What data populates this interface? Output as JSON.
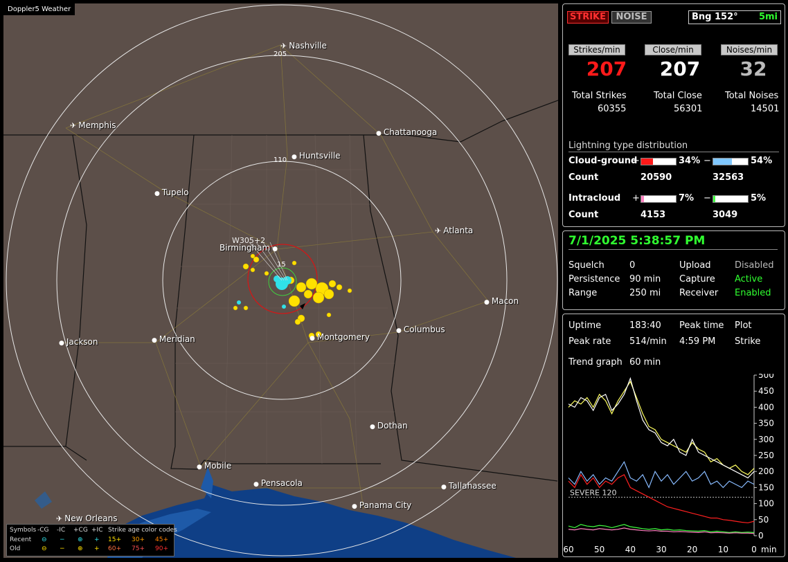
{
  "app_title": "Doppler5 Weather",
  "map": {
    "cities": [
      {
        "name": "Nashville",
        "airport": true
      },
      {
        "name": "Memphis",
        "airport": true
      },
      {
        "name": "Chattanooga",
        "airport": false
      },
      {
        "name": "Huntsville",
        "airport": false
      },
      {
        "name": "Tupelo",
        "airport": false
      },
      {
        "name": "Atlanta",
        "airport": true
      },
      {
        "name": "Birmingham",
        "airport": false
      },
      {
        "name": "Macon",
        "airport": false
      },
      {
        "name": "Columbus",
        "airport": false
      },
      {
        "name": "Jackson",
        "airport": false
      },
      {
        "name": "Meridian",
        "airport": false
      },
      {
        "name": "Montgomery",
        "airport": false
      },
      {
        "name": "Dothan",
        "airport": false
      },
      {
        "name": "Mobile",
        "airport": false
      },
      {
        "name": "Pensacola",
        "airport": false
      },
      {
        "name": "Tallahassee",
        "airport": false
      },
      {
        "name": "Panama City",
        "airport": false
      },
      {
        "name": "New Orleans",
        "airport": true
      }
    ],
    "range_labels": [
      "205",
      "110",
      "15"
    ]
  },
  "legend": {
    "header": [
      "Symbols",
      "-CG",
      "-IC",
      "+CG",
      "+IC",
      "Strike age color codes"
    ],
    "recent": {
      "label": "Recent",
      "ages": [
        "15+",
        "30+",
        "45+"
      ]
    },
    "old": {
      "label": "Old",
      "ages": [
        "60+",
        "75+",
        "90+"
      ]
    }
  },
  "status": {
    "strike_label": "STRIKE",
    "noise_label": "NOISE",
    "bearing": "Bng 152°",
    "distance": "5mi",
    "strikes_min_label": "Strikes/min",
    "close_min_label": "Close/min",
    "noises_min_label": "Noises/min",
    "strikes_min": "207",
    "close_min": "207",
    "noises_min": "32",
    "total_strikes_label": "Total Strikes",
    "total_close_label": "Total Close",
    "total_noises_label": "Total Noises",
    "total_strikes": "60355",
    "total_close": "56301",
    "total_noises": "14501",
    "dist_title": "Lightning type distribution",
    "cg_label": "Cloud-ground",
    "plus": "+",
    "minus": "−",
    "cg_pos_pct": "34%",
    "cg_neg_pct": "54%",
    "cg_pos_fraction": 0.34,
    "cg_neg_fraction": 0.54,
    "count_label": "Count",
    "cg_pos_count": "20590",
    "cg_neg_count": "32563",
    "ic_label": "Intracloud",
    "ic_pos_pct": "7%",
    "ic_neg_pct": "5%",
    "ic_pos_fraction": 0.07,
    "ic_neg_fraction": 0.05,
    "ic_pos_count": "4153",
    "ic_neg_count": "3049"
  },
  "settings": {
    "datetime": "7/1/2025 5:38:57 PM",
    "squelch_label": "Squelch",
    "squelch": "0",
    "persistence_label": "Persistence",
    "persistence": "90 min",
    "range_label": "Range",
    "range": "250 mi",
    "upload_label": "Upload",
    "upload": "Disabled",
    "capture_label": "Capture",
    "capture": "Active",
    "receiver_label": "Receiver",
    "receiver": "Enabled"
  },
  "trend": {
    "uptime_label": "Uptime",
    "uptime": "183:40",
    "peak_time_label": "Peak time",
    "peak_time": "4:59 PM",
    "plot_label": "Plot",
    "plot": "Strike",
    "peak_rate_label": "Peak rate",
    "peak_rate": "514/min",
    "trend_label": "Trend graph",
    "trend_window": "60 min",
    "severe_label": "SEVERE 120",
    "y_ticks": [
      "500",
      "450",
      "400",
      "350",
      "300",
      "250",
      "200",
      "150",
      "100",
      "50",
      "0"
    ],
    "x_ticks": [
      "60",
      "50",
      "40",
      "30",
      "20",
      "10",
      "0"
    ],
    "x_unit": "min"
  },
  "chart_data": {
    "type": "line",
    "title": "",
    "xlabel": "min",
    "ylabel": "",
    "xlim": [
      60,
      0
    ],
    "ylim": [
      0,
      500
    ],
    "x": [
      60,
      58,
      56,
      54,
      52,
      50,
      48,
      46,
      44,
      42,
      40,
      38,
      36,
      34,
      32,
      30,
      28,
      26,
      24,
      22,
      20,
      18,
      16,
      14,
      12,
      10,
      8,
      6,
      4,
      2,
      0
    ],
    "series": [
      {
        "color": "#ffff60",
        "values": [
          400,
          420,
          410,
          430,
          400,
          440,
          420,
          380,
          420,
          450,
          480,
          430,
          380,
          340,
          330,
          300,
          290,
          280,
          270,
          260,
          290,
          270,
          260,
          230,
          240,
          220,
          210,
          220,
          200,
          190,
          210
        ]
      },
      {
        "color": "#ffffff",
        "values": [
          410,
          400,
          430,
          420,
          390,
          430,
          440,
          390,
          410,
          440,
          490,
          420,
          360,
          330,
          320,
          290,
          280,
          300,
          260,
          250,
          300,
          260,
          250,
          240,
          230,
          220,
          210,
          200,
          190,
          180,
          200
        ]
      },
      {
        "color": "#88bbff",
        "values": [
          180,
          160,
          200,
          170,
          190,
          160,
          180,
          170,
          200,
          230,
          180,
          170,
          190,
          150,
          200,
          170,
          190,
          160,
          180,
          200,
          170,
          180,
          200,
          160,
          170,
          150,
          170,
          160,
          150,
          170,
          160
        ]
      },
      {
        "color": "#ff2020",
        "values": [
          170,
          150,
          190,
          160,
          180,
          150,
          170,
          160,
          180,
          190,
          150,
          140,
          130,
          120,
          110,
          100,
          90,
          85,
          80,
          75,
          70,
          65,
          60,
          55,
          55,
          50,
          48,
          45,
          42,
          40,
          45
        ]
      },
      {
        "color": "#40ff40",
        "values": [
          30,
          25,
          35,
          30,
          28,
          32,
          30,
          25,
          30,
          35,
          28,
          25,
          22,
          20,
          22,
          18,
          20,
          17,
          18,
          16,
          15,
          14,
          16,
          12,
          14,
          12,
          10,
          12,
          10,
          11,
          10
        ]
      },
      {
        "color": "#ff80c0",
        "values": [
          20,
          18,
          22,
          20,
          18,
          22,
          20,
          18,
          20,
          24,
          20,
          18,
          16,
          15,
          16,
          14,
          14,
          12,
          13,
          12,
          11,
          10,
          12,
          9,
          10,
          9,
          8,
          9,
          8,
          8,
          7
        ]
      }
    ],
    "reference_line": {
      "value": 120,
      "label": "SEVERE 120"
    }
  }
}
